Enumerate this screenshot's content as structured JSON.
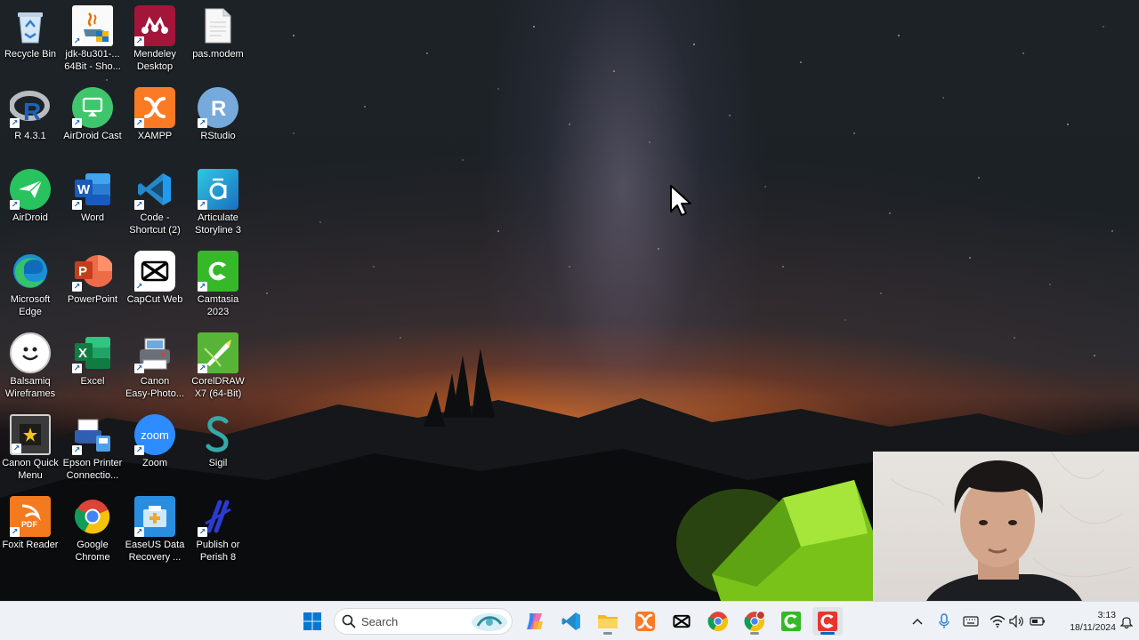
{
  "desktop": {
    "icons": [
      {
        "label": "Recycle Bin",
        "icon": "recycle-bin-icon"
      },
      {
        "label": "jdk-8u301-...\n64Bit - Sho...",
        "icon": "java-icon"
      },
      {
        "label": "Mendeley\nDesktop",
        "icon": "mendeley-icon"
      },
      {
        "label": "pas.modem",
        "icon": "file-icon"
      },
      {
        "label": "R 4.3.1",
        "icon": "r-icon"
      },
      {
        "label": "AirDroid Cast",
        "icon": "airdroid-cast-icon"
      },
      {
        "label": "XAMPP",
        "icon": "xampp-icon"
      },
      {
        "label": "RStudio",
        "icon": "rstudio-icon"
      },
      {
        "label": "AirDroid",
        "icon": "airdroid-icon"
      },
      {
        "label": "Word",
        "icon": "word-icon"
      },
      {
        "label": "Code -\nShortcut (2)",
        "icon": "vscode-icon"
      },
      {
        "label": "Articulate\nStoryline 3",
        "icon": "articulate-icon"
      },
      {
        "label": "Microsoft\nEdge",
        "icon": "edge-icon"
      },
      {
        "label": "PowerPoint",
        "icon": "powerpoint-icon"
      },
      {
        "label": "CapCut Web",
        "icon": "capcut-icon"
      },
      {
        "label": "Camtasia\n2023",
        "icon": "camtasia-icon"
      },
      {
        "label": "Balsamiq\nWireframes",
        "icon": "balsamiq-icon"
      },
      {
        "label": "Excel",
        "icon": "excel-icon"
      },
      {
        "label": "Canon\nEasy-Photo...",
        "icon": "canon-printer-icon"
      },
      {
        "label": "CorelDRAW\nX7 (64-Bit)",
        "icon": "coreldraw-icon"
      },
      {
        "label": "Canon Quick\nMenu",
        "icon": "canon-quick-menu-icon"
      },
      {
        "label": "Epson Printer\nConnectio...",
        "icon": "epson-icon"
      },
      {
        "label": "Zoom",
        "icon": "zoom-icon"
      },
      {
        "label": "Sigil",
        "icon": "sigil-icon"
      },
      {
        "label": "Foxit Reader",
        "icon": "foxit-icon"
      },
      {
        "label": "Google\nChrome",
        "icon": "chrome-icon"
      },
      {
        "label": "EaseUS Data\nRecovery ...",
        "icon": "easeus-icon"
      },
      {
        "label": "Publish or\nPerish 8",
        "icon": "publish-or-perish-icon"
      }
    ],
    "zoom_logo_text": "zoom",
    "mendeley_logo_text": "M"
  },
  "taskbar": {
    "search_placeholder": "Search",
    "pinned": [
      "start-icon",
      "search-icon",
      "copilot-icon",
      "vscode-icon",
      "file-explorer-icon",
      "xampp-icon",
      "capcut-icon",
      "chrome-icon",
      "chrome-profile-icon",
      "camtasia-icon",
      "camtasia-recorder-icon"
    ],
    "tray": [
      "chevron-up-icon",
      "microphone-icon",
      "keyboard-icon",
      "wifi-icon",
      "speaker-icon",
      "battery-icon",
      "notification-icon"
    ],
    "time": "3:13",
    "date": "18/11/2024"
  },
  "colors": {
    "taskbar_bg": "#eef1f5",
    "accent": "#0067c0"
  }
}
